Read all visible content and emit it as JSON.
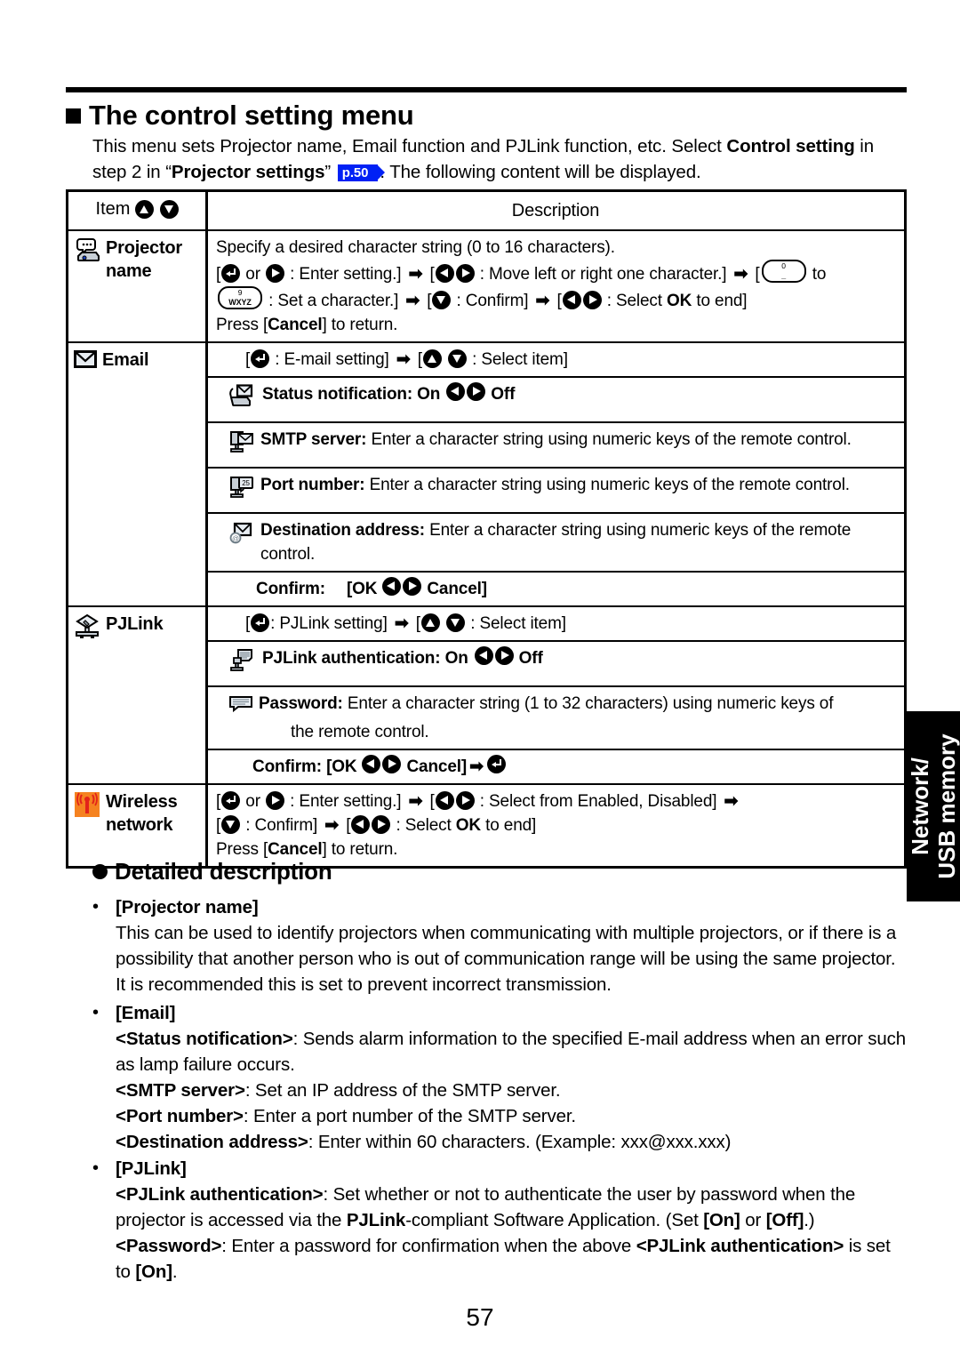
{
  "page": {
    "number": "57",
    "side_tab": "Network/\nUSB memory",
    "heading": "The control setting menu",
    "intro": {
      "part1": "This menu sets Projector name, Email function and PJLink function, etc. Select ",
      "bold1": "Control setting",
      "part2": " in step 2 in “",
      "bold2": "Projector settings",
      "part3": "” ",
      "page_ref": "p.50",
      "part4": ". The following content will be displayed."
    }
  },
  "table": {
    "header": {
      "item": "Item",
      "description": "Description"
    },
    "rows": [
      {
        "icon": "projector-name-icon",
        "label": "Projector\nname",
        "lines": [
          "Specify a desired character string (0 to 16 characters).",
          "[(enter) or (right) : Enter setting.] → [(left)(right) : Move left or right one character.] → [(key0) to (key9wxyz) : Set a character.] → [(down) : Confirm] → [(left)(right) : Select OK to end]",
          "Press [Cancel] to return."
        ],
        "line1": "Specify a desired character string (0 to 16 characters).",
        "seg_or": "or",
        "seg_enter_setting": ": Enter setting.]",
        "seg_move": ": Move left or right one character.]",
        "seg_to": "to",
        "seg_setchar": ": Set a character.]",
        "seg_confirm": ": Confirm]",
        "seg_select_ok": ": Select",
        "seg_ok": "OK",
        "seg_to_end": "to end]",
        "press_cancel_pre": "Press [",
        "press_cancel_bold": "Cancel",
        "press_cancel_post": "] to return.",
        "key0_top": "0",
        "key0_bottom": "",
        "key9_top": "9",
        "key9_bottom": "WXYZ"
      },
      {
        "icon": "email-icon",
        "label": "Email",
        "first_line": ": E-mail setting] → [(up)(down) : Select item]",
        "first_a": ": E-mail setting]",
        "first_b": ": Select item]",
        "subrows": [
          {
            "icon": "status-notification-icon",
            "bold": "Status notification: On",
            "after": "Off",
            "style": "bold-centerish"
          },
          {
            "icon": "smtp-server-icon",
            "bold": "SMTP server:",
            "text": " Enter a character string using numeric keys of the remote control."
          },
          {
            "icon": "port-number-icon",
            "bold": "Port number:",
            "text": " Enter a character string using numeric keys of the remote control."
          },
          {
            "icon": "destination-address-icon",
            "bold": "Destination address:",
            "text": " Enter a character string using numeric keys of the remote control."
          },
          {
            "icon": "",
            "bold": "Confirm:",
            "text": "[OK",
            "after": "Cancel]"
          }
        ]
      },
      {
        "icon": "pjlink-icon",
        "label": "PJLink",
        "first_a": ": PJLink setting]",
        "first_b": ": Select item]",
        "subrows": [
          {
            "icon": "pjlink-auth-icon",
            "bold": "PJLink authentication: On",
            "after": "Off"
          },
          {
            "icon": "password-icon",
            "bold": "Password:",
            "text": " Enter a character string (1 to 32 characters) using numeric keys of",
            "text2": "the remote control."
          },
          {
            "icon": "",
            "bold": "Confirm: [OK",
            "after": "Cancel]"
          }
        ]
      },
      {
        "icon": "wireless-network-icon",
        "label": "Wireless\nnetwork",
        "seg_or": "or",
        "seg_enter_setting": ": Enter setting.]",
        "seg_select_from": ": Select from Enabled, Disabled]",
        "seg_confirm": ": Confirm]",
        "seg_select": ": Select",
        "seg_ok": "OK",
        "seg_to_end": "to end]",
        "press_cancel_pre": "Press [",
        "press_cancel_bold": "Cancel",
        "press_cancel_post": "] to return."
      }
    ]
  },
  "detailed": {
    "title": "Detailed description",
    "sections": [
      {
        "bullet": "•",
        "heading": "[Projector name]",
        "body": "This can be used to identify projectors when communicating with multiple projectors, or if there is a possibility that another person who is out of communication range will be using the same projector. It is recommended this is set to prevent incorrect transmission."
      },
      {
        "bullet": "•",
        "heading": "[Email]",
        "line_status_bold": "<Status notification>",
        "line_status_text": ": Sends alarm information to the specified E-mail address when an error such as lamp failure occurs.",
        "line_smtp_bold": "<SMTP server>",
        "line_smtp_text": ": Set an IP address of the SMTP server.",
        "line_port_bold": "<Port number>",
        "line_port_text": ": Enter a port number of the SMTP server.",
        "line_dest_bold": "<Destination address>",
        "line_dest_text": ": Enter within 60 characters. (Example: xxx@xxx.xxx)"
      },
      {
        "bullet": "•",
        "heading": "[PJLink]",
        "auth_bold": "<PJLink authentication>",
        "auth_text1": ": Set whether or not to authenticate the user by password when the projector is accessed via the ",
        "auth_bold2": "PJLink",
        "auth_text2": "-compliant Software Application. (Set ",
        "auth_bold3": "[On]",
        "auth_text3": " or ",
        "auth_bold4": "[Off]",
        "auth_text4": ".)",
        "pw_bold": "<Password>",
        "pw_text1": ": Enter a password for confirmation when the above ",
        "pw_bold2": "<PJLink authentication>",
        "pw_text2": " is set to ",
        "pw_bold3": "[On]",
        "pw_text3": "."
      }
    ]
  },
  "colors": {
    "page_ref_bg": "#0021f5",
    "wireless_icon_bg": "#f58220",
    "tab_bg": "#000000"
  }
}
